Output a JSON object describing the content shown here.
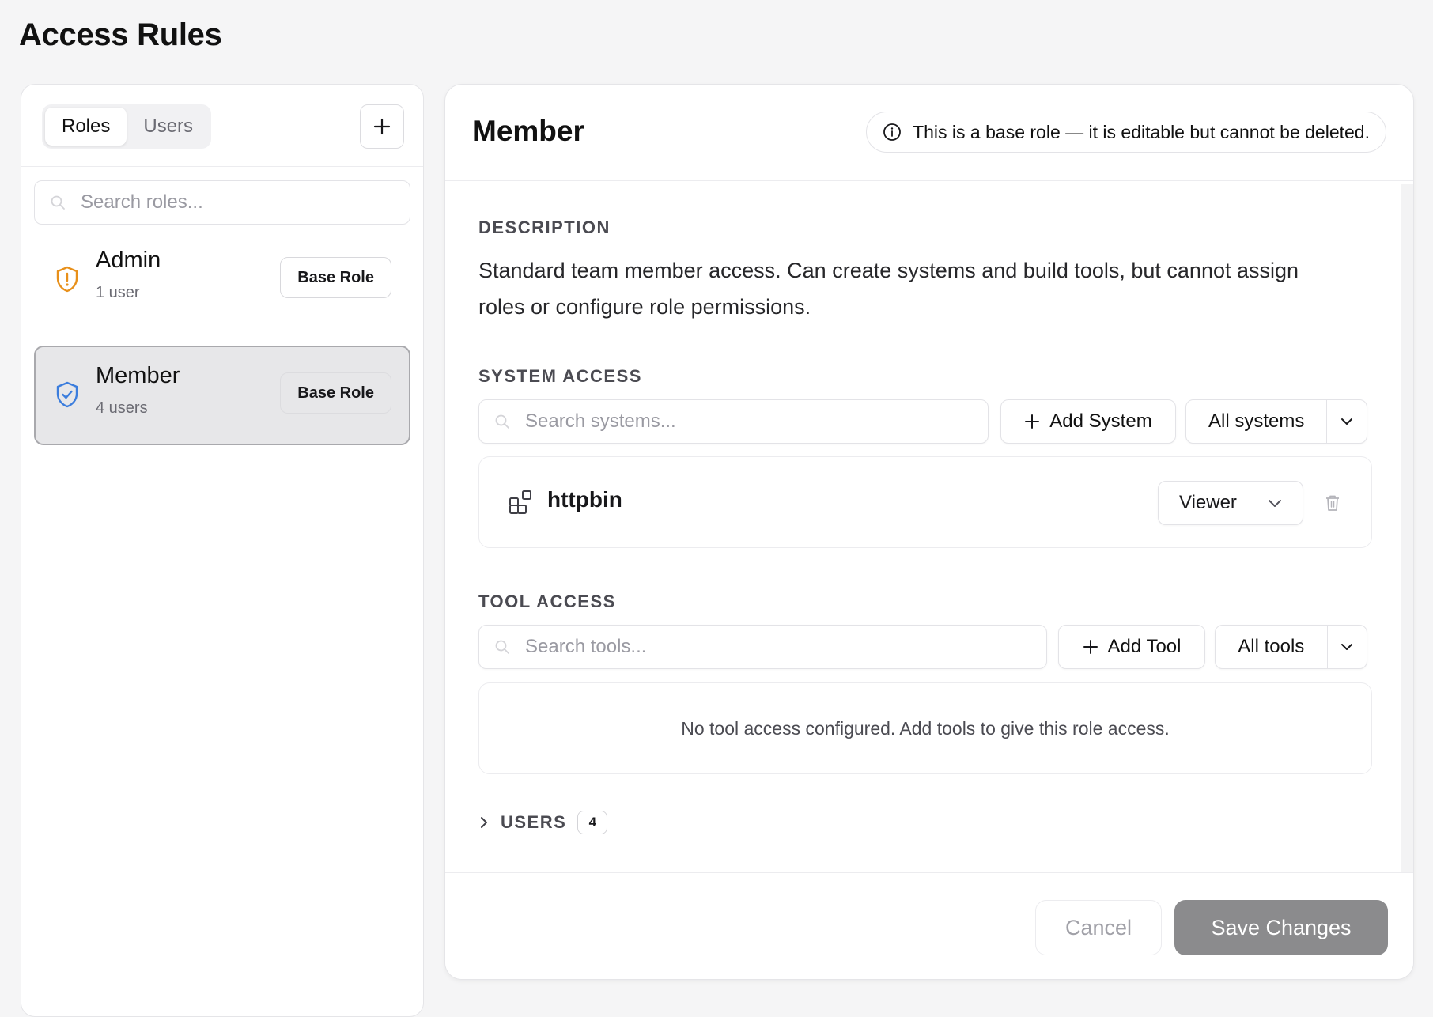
{
  "page": {
    "title": "Access Rules"
  },
  "sidebar": {
    "tabs": [
      {
        "label": "Roles",
        "active": true
      },
      {
        "label": "Users",
        "active": false
      }
    ],
    "add_icon": "plus-icon",
    "search_placeholder": "Search roles...",
    "roles": [
      {
        "name": "Admin",
        "count": "1 user",
        "badge": "Base Role",
        "icon": "shield-alert-icon",
        "icon_color": "#e8901a",
        "selected": false
      },
      {
        "name": "Member",
        "count": "4 users",
        "badge": "Base Role",
        "icon": "shield-check-icon",
        "icon_color": "#3b7ddd",
        "selected": true
      }
    ]
  },
  "detail": {
    "title": "Member",
    "notice": "This is a base role — it is editable but cannot be deleted.",
    "description_label": "DESCRIPTION",
    "description": "Standard team member access. Can create systems and build tools, but cannot assign roles or configure role permissions.",
    "system_access": {
      "label": "SYSTEM ACCESS",
      "search_placeholder": "Search systems...",
      "add_label": "Add System",
      "filter_label": "All systems",
      "items": [
        {
          "name": "httpbin",
          "role": "Viewer",
          "icon": "system-grid-icon"
        }
      ]
    },
    "tool_access": {
      "label": "TOOL ACCESS",
      "search_placeholder": "Search tools...",
      "add_label": "Add Tool",
      "filter_label": "All tools",
      "empty_message": "No tool access configured. Add tools to give this role access."
    },
    "users": {
      "label": "USERS",
      "count": "4"
    },
    "footer": {
      "cancel_label": "Cancel",
      "save_label": "Save Changes"
    }
  },
  "colors": {
    "accent_admin": "#e8901a",
    "accent_member": "#3b7ddd",
    "save_disabled": "#8b8b8d"
  }
}
